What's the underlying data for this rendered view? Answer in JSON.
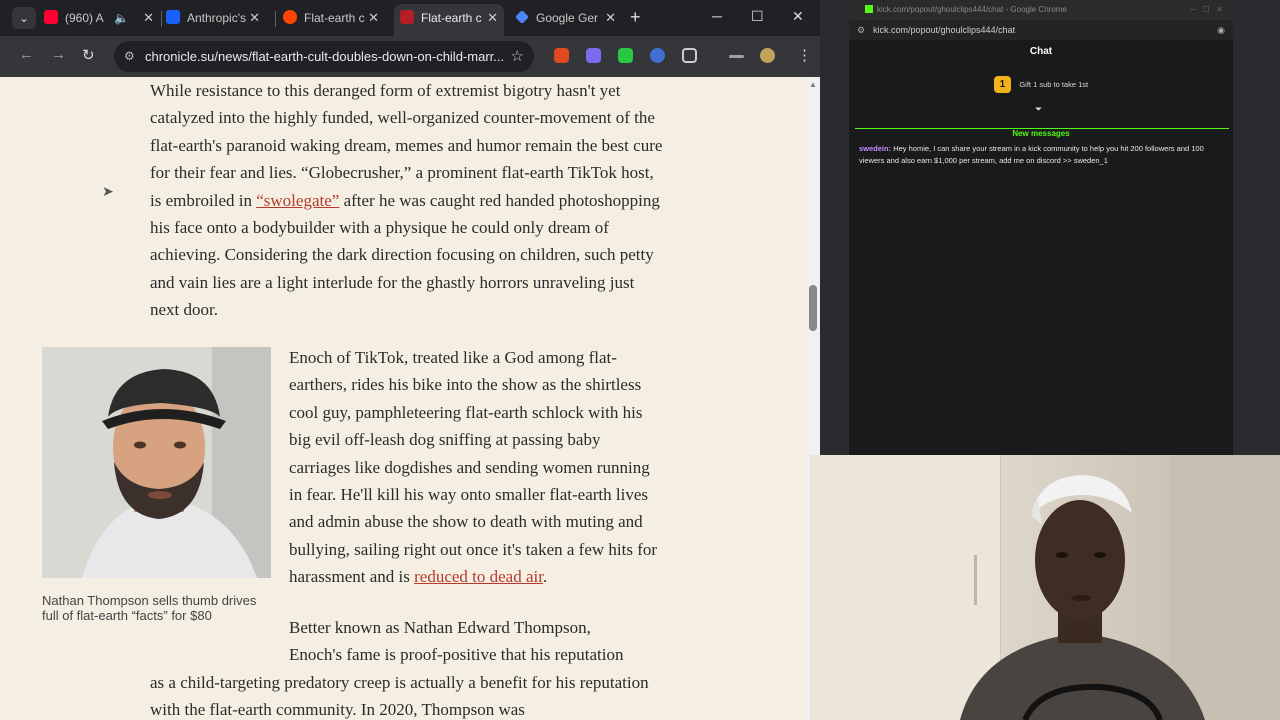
{
  "tabs": [
    {
      "label": "(960) A",
      "color": "#ff0033",
      "has_audio": true
    },
    {
      "label": "Anthropic's",
      "color": "#1c5fff"
    },
    {
      "label": "Flat-earth c",
      "color": "#ff4500"
    },
    {
      "label": "Flat-earth c",
      "color": "#b41f26",
      "active": true
    },
    {
      "label": "Google Ger",
      "color": "#4a86f7"
    }
  ],
  "address": "chronicle.su/news/flat-earth-cult-doubles-down-on-child-marr...",
  "article": {
    "para1_before": "While resistance to this deranged form of extremist bigotry hasn't yet catalyzed into the highly funded, well-organized counter-movement of the flat-earth's paranoid waking dream, memes and humor remain the best cure for their fear and lies. “Globecrusher,” a prominent flat-earth TikTok host, is embroiled in ",
    "para1_link": "“swolegate”",
    "para1_after": " after he was caught red handed photoshopping his face onto a bodybuilder with a physique he could only dream of achieving. Considering the dark direction focusing on children, such petty and vain lies are a light interlude for the ghastly horrors unraveling just next door.",
    "para2_before": "Enoch of TikTok, treated like a God among flat-earthers, rides his bike into the show as the shirtless cool guy, pamphleteering flat-earth schlock with his big evil off-leash dog sniffing at passing baby carriages like dogdishes and sending women running in fear. He'll kill his way onto smaller flat-earth lives and admin abuse the show to death with muting and bullying, sailing right out once it's taken a few hits for harassment and is ",
    "para2_link": "reduced to dead air",
    "para2_after": ".",
    "para3_a": "Better known as Nathan Edward Thompson,",
    "para3_b": "Enoch's fame is proof-positive that his reputation",
    "para4": "as a child-targeting predatory creep is actually a benefit for his reputation with the flat-earth community. In 2020, Thompson was",
    "caption": "Nathan Thompson sells thumb drives full of flat-earth “facts” for $80"
  },
  "chat": {
    "window_title": "kick.com/popout/ghoulclips444/chat - Google Chrome",
    "url": "kick.com/popout/ghoulclips444/chat",
    "heading": "Chat",
    "gift_rank": "1",
    "gift_text": "Gift 1 sub to take 1st",
    "new_messages_label": "New messages",
    "message_user": "swedein",
    "message_text": "Hey homie, I can share your stream in a kick community to help you hit 200 followers and 100 viewers and also earn $1,000 per stream, add me on discord >> sweden_1",
    "accent": "#53fc18",
    "user_color": "#c78cff"
  }
}
